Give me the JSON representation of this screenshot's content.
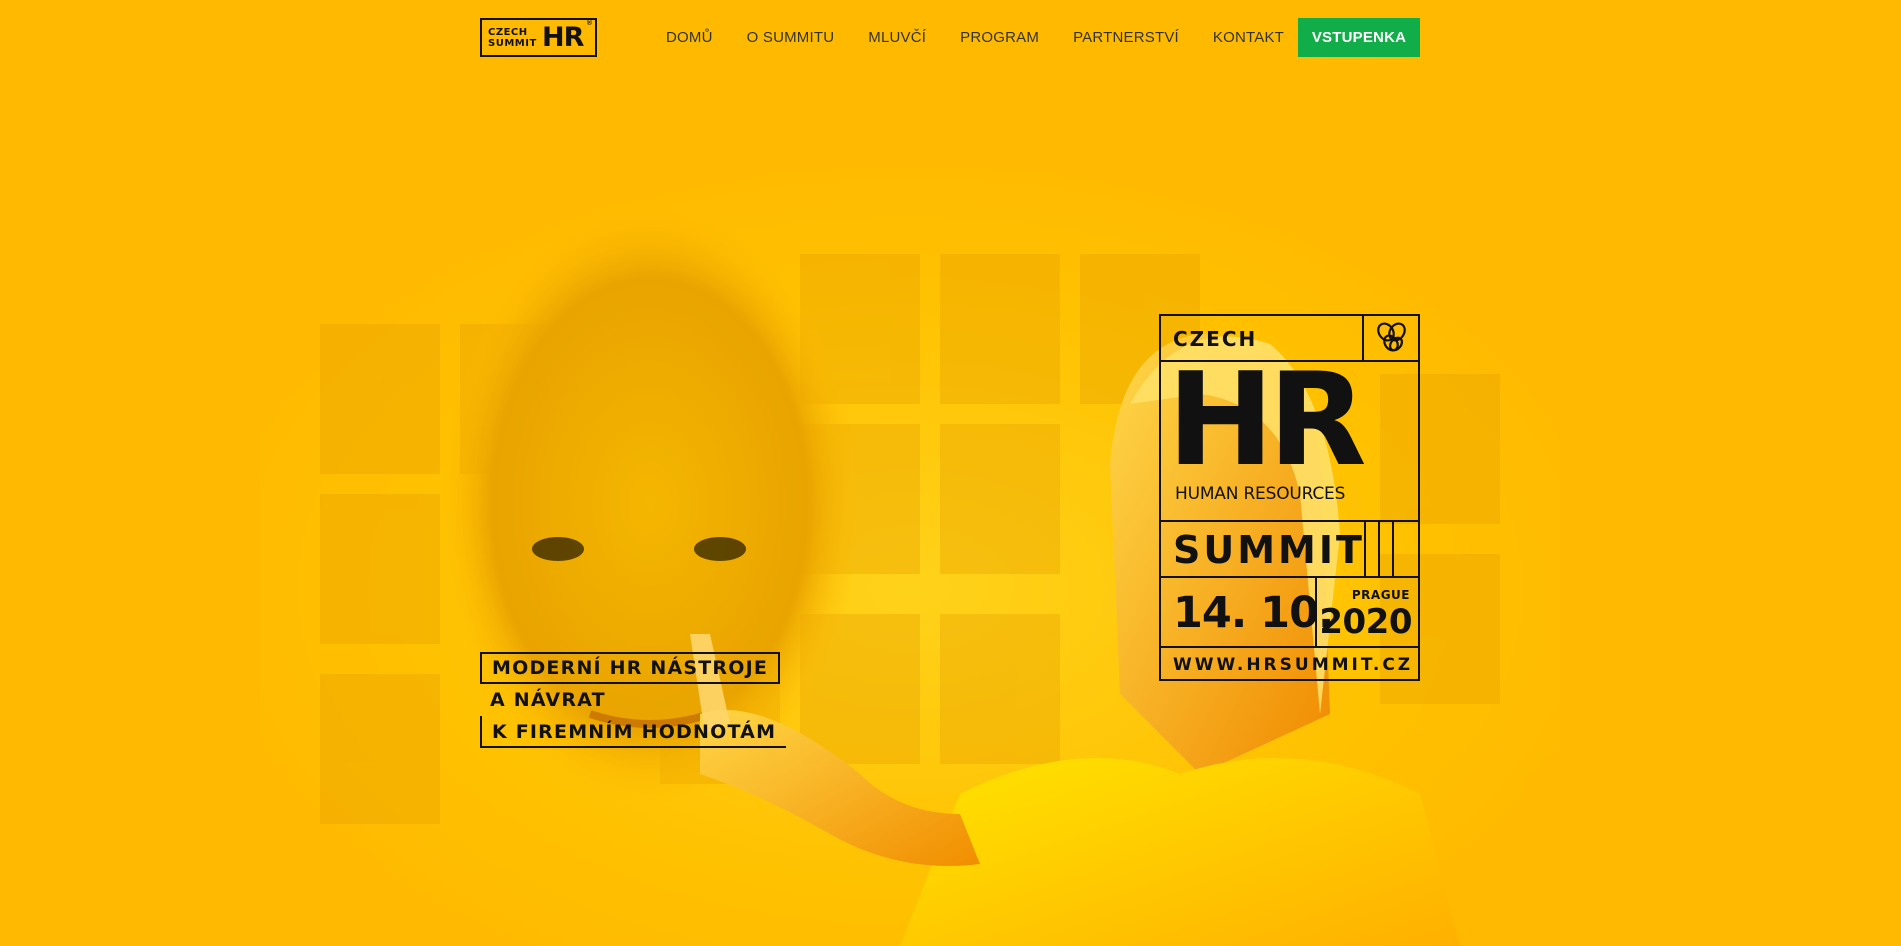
{
  "header": {
    "logo": {
      "line1": "CZECH",
      "line2": "SUMMIT",
      "mark": "HR",
      "reg": "®"
    },
    "nav": [
      {
        "label": "DOMŮ"
      },
      {
        "label": "O SUMMITU"
      },
      {
        "label": "MLUVČÍ"
      },
      {
        "label": "PROGRAM"
      },
      {
        "label": "PARTNERSTVÍ"
      },
      {
        "label": "KONTAKT"
      }
    ],
    "cta_label": "VSTUPENKA"
  },
  "hero": {
    "tagline": [
      "MODERNÍ HR NÁSTROJE",
      "A NÁVRAT",
      "K FIREMNÍM HODNOTÁM"
    ],
    "badge": {
      "czech": "CZECH",
      "hr": "HR",
      "hr_sub": "HUMAN RESOURCES",
      "summit": "SUMMIT",
      "date": "14. 10.",
      "city": "PRAGUE",
      "year": "2020",
      "web": "WWW.HRSUMMIT.CZ",
      "icon": "bee-icon"
    }
  },
  "colors": {
    "background": "#ffba00",
    "cta": "#10ad48",
    "ink": "#111111"
  }
}
